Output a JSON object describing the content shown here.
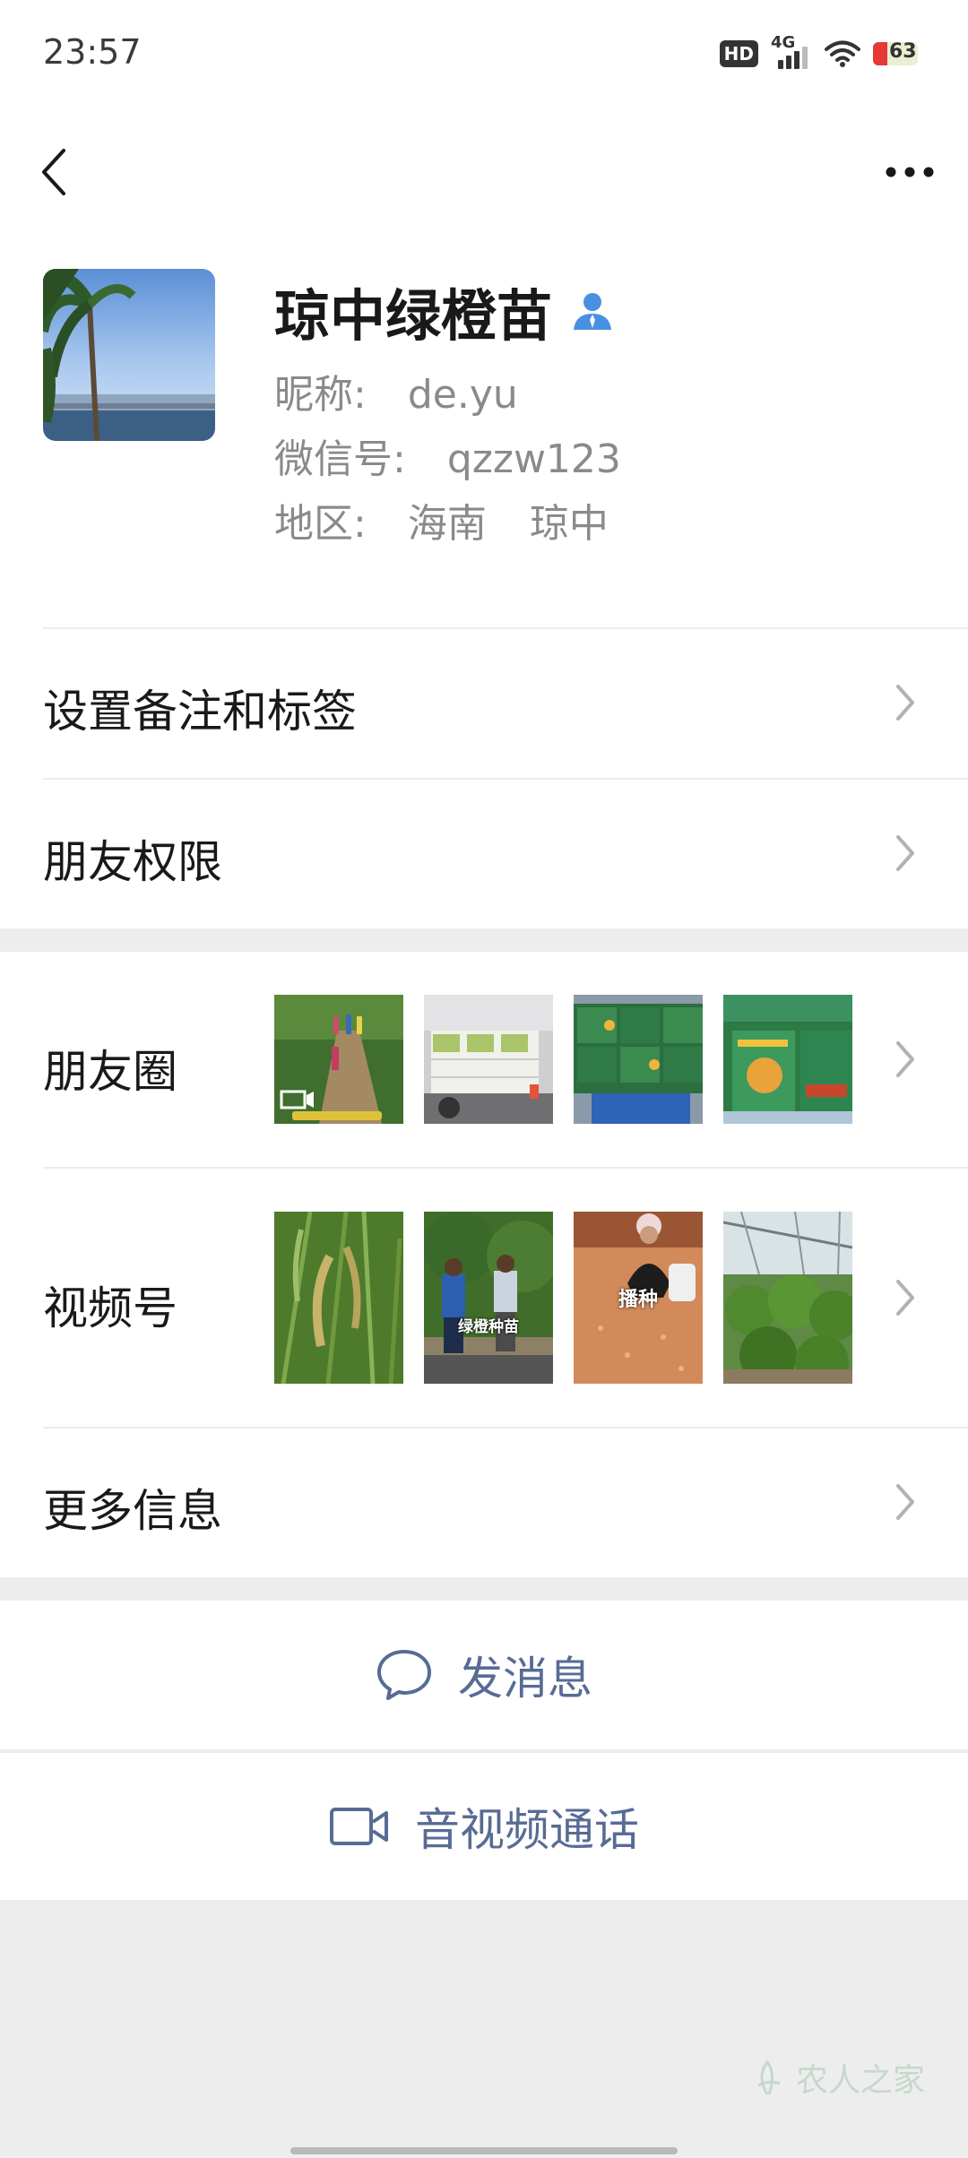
{
  "status": {
    "time": "23:57",
    "hd": "HD",
    "network": "4G",
    "battery": "63"
  },
  "profile": {
    "name": "琼中绿橙苗",
    "nickname_label": "昵称:",
    "nickname": "de.yu",
    "wechat_id_label": "微信号:",
    "wechat_id": "qzzw123",
    "region_label": "地区:",
    "region_province": "海南",
    "region_city": "琼中"
  },
  "menu": {
    "remark_tags": "设置备注和标签",
    "friend_permissions": "朋友权限",
    "moments": "朋友圈",
    "channels": "视频号",
    "more_info": "更多信息"
  },
  "moments_thumbs": [
    {
      "caption": ""
    },
    {
      "caption": ""
    },
    {
      "caption": ""
    },
    {
      "caption": ""
    }
  ],
  "channels_thumbs": [
    {
      "caption": ""
    },
    {
      "caption": "绿橙种苗"
    },
    {
      "caption": "播种"
    },
    {
      "caption": ""
    }
  ],
  "actions": {
    "send_message": "发消息",
    "av_call": "音视频通话"
  },
  "watermark": "农人之家",
  "colors": {
    "link_blue": "#576b95",
    "verified_blue": "#4a90e2",
    "page_bg": "#ededed"
  }
}
